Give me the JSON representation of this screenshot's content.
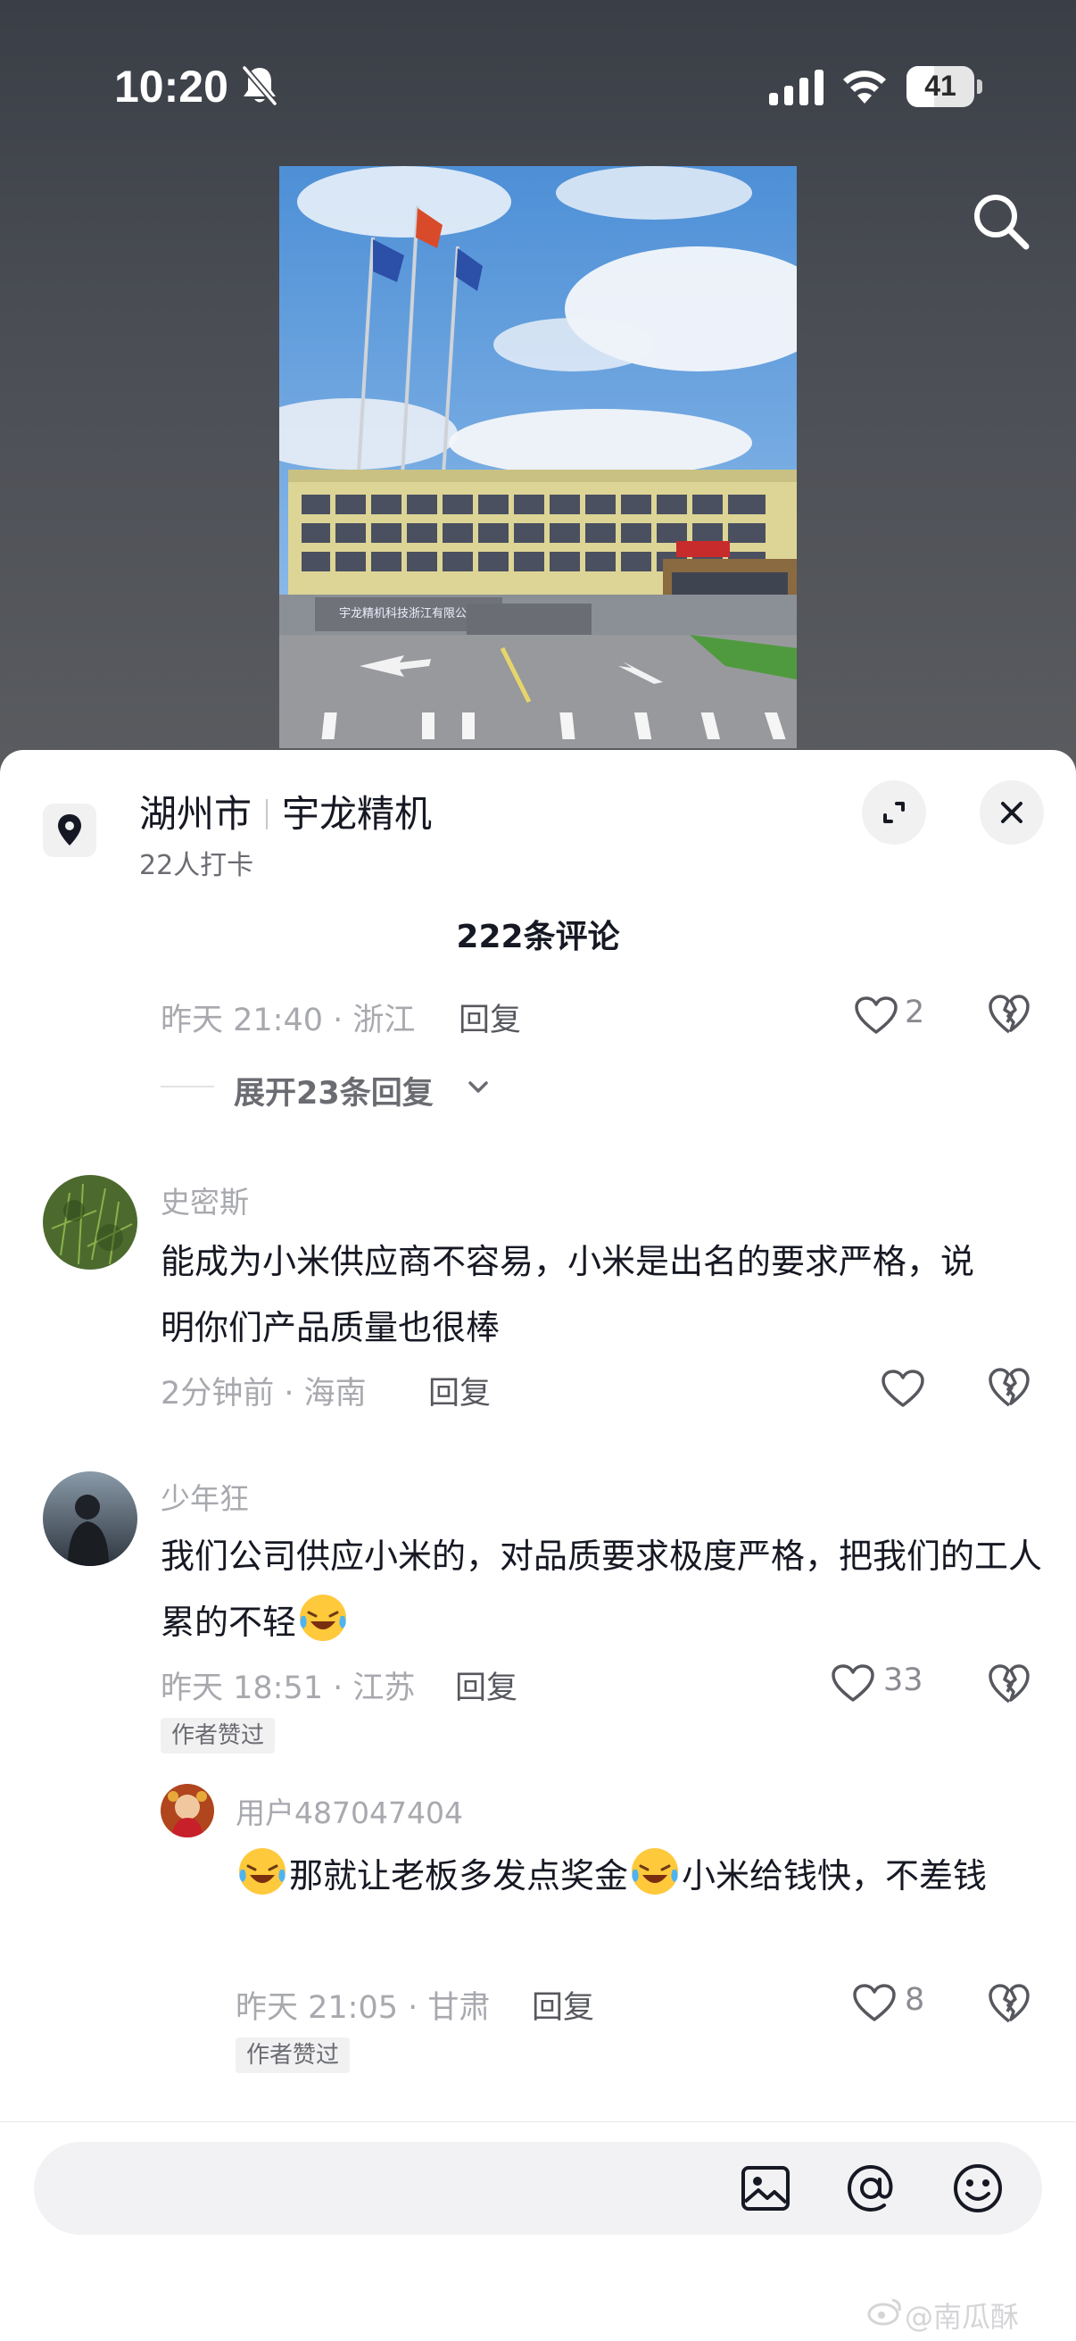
{
  "status_bar": {
    "time": "10:20",
    "battery": "41",
    "battery_level": 0.41,
    "icons": [
      "bell-off-icon",
      "cellular-signal-icon",
      "wifi-icon",
      "battery-icon"
    ]
  },
  "video": {
    "search_icon": "search-icon",
    "sign_text": "宇龙精机科技浙江有限公司"
  },
  "poi": {
    "city": "湖州市",
    "name": "宇龙精机",
    "checkins": "22人打卡",
    "icon": "location-pin-icon"
  },
  "comments_header": {
    "count_label": "222条评论",
    "expand_icon": "expand-icon",
    "close_icon": "close-icon"
  },
  "comments": [
    {
      "meta": "昨天 21:40 · 浙江",
      "reply_label": "回复",
      "likes": "2",
      "expand_replies": "展开23条回复"
    },
    {
      "user": "史密斯",
      "text": "能成为小米供应商不容易，小米是出名的要求严格，说明你们产品质量也很棒",
      "meta": "2分钟前 · 海南",
      "reply_label": "回复",
      "likes": ""
    },
    {
      "user": "少年狂",
      "text": "我们公司供应小米的，对品质要求极度严格，把我们的工人累的不轻",
      "meta": "昨天 18:51 · 江苏",
      "reply_label": "回复",
      "likes": "33",
      "badge": "作者赞过"
    },
    {
      "user": "用户487047404",
      "text_part1": "那就让老板多发点奖金",
      "text_part2": "小米给钱快，不差钱",
      "meta": "昨天 21:05 · 甘肃",
      "reply_label": "回复",
      "likes": "8",
      "badge": "作者赞过"
    }
  ],
  "input_bar": {
    "placeholder": "",
    "icons": [
      "image-icon",
      "at-mention-icon",
      "emoji-icon"
    ]
  },
  "watermark": "@南瓜酥"
}
